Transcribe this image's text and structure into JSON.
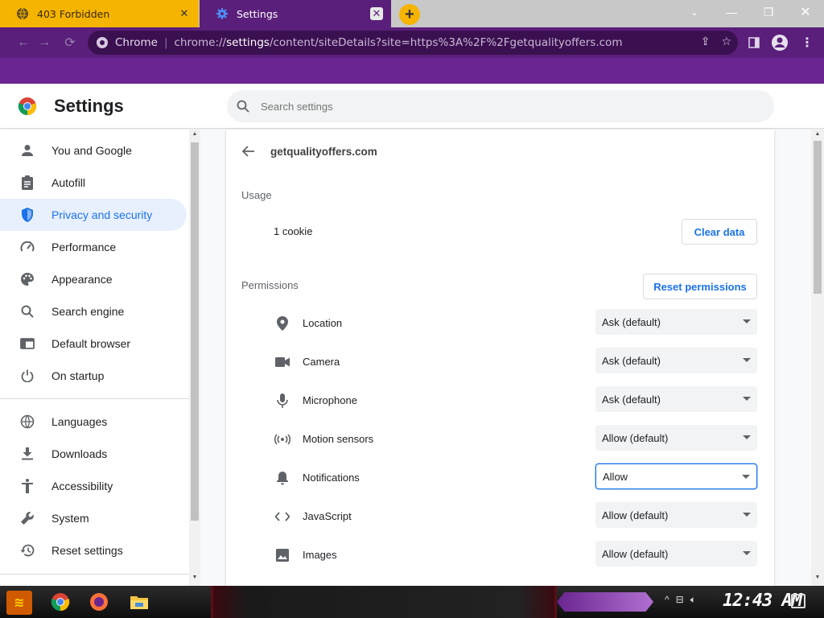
{
  "browser": {
    "tabs": [
      {
        "title": "403 Forbidden",
        "active": false
      },
      {
        "title": "Settings",
        "active": true
      }
    ],
    "new_tab": "+",
    "window_controls": {
      "dropdown": "⌄",
      "minimize": "—",
      "restore": "❐",
      "close": "✕"
    },
    "omnibox": {
      "origin_label": "Chrome",
      "separator": "|",
      "url_prefix": "chrome://",
      "url_host": "settings",
      "url_rest": "/content/siteDetails?site=https%3A%2F%2Fgetqualityoffers.com"
    }
  },
  "header": {
    "title": "Settings",
    "search_placeholder": "Search settings"
  },
  "sidebar": {
    "items": [
      {
        "label": "You and Google",
        "icon": "person-icon",
        "active": false
      },
      {
        "label": "Autofill",
        "icon": "clipboard-icon",
        "active": false
      },
      {
        "label": "Privacy and security",
        "icon": "shield-icon",
        "active": true
      },
      {
        "label": "Performance",
        "icon": "speedometer-icon",
        "active": false
      },
      {
        "label": "Appearance",
        "icon": "palette-icon",
        "active": false
      },
      {
        "label": "Search engine",
        "icon": "search-icon",
        "active": false
      },
      {
        "label": "Default browser",
        "icon": "browser-window-icon",
        "active": false
      },
      {
        "label": "On startup",
        "icon": "power-icon",
        "active": false
      },
      {
        "label": "Languages",
        "icon": "globe-icon",
        "active": false
      },
      {
        "label": "Downloads",
        "icon": "download-icon",
        "active": false
      },
      {
        "label": "Accessibility",
        "icon": "accessibility-icon",
        "active": false
      },
      {
        "label": "System",
        "icon": "wrench-icon",
        "active": false
      },
      {
        "label": "Reset settings",
        "icon": "history-icon",
        "active": false
      }
    ]
  },
  "site": {
    "title": "getqualityoffers.com",
    "usage_heading": "Usage",
    "cookie_count": "1 cookie",
    "clear_data": "Clear data",
    "permissions_heading": "Permissions",
    "reset_permissions": "Reset permissions",
    "permissions": [
      {
        "name": "Location",
        "value": "Ask (default)",
        "icon": "location-pin-icon"
      },
      {
        "name": "Camera",
        "value": "Ask (default)",
        "icon": "camera-icon"
      },
      {
        "name": "Microphone",
        "value": "Ask (default)",
        "icon": "microphone-icon"
      },
      {
        "name": "Motion sensors",
        "value": "Allow (default)",
        "icon": "motion-sensor-icon"
      },
      {
        "name": "Notifications",
        "value": "Allow",
        "icon": "bell-icon",
        "focused": true
      },
      {
        "name": "JavaScript",
        "value": "Allow (default)",
        "icon": "code-icon"
      },
      {
        "name": "Images",
        "value": "Allow (default)",
        "icon": "image-icon"
      }
    ]
  },
  "taskbar": {
    "clock": "12:43 AM"
  },
  "colors": {
    "accent": "#1a73e8",
    "active_nav_bg": "#e8f0fe",
    "toolbar": "#5a1f7a",
    "tab_inactive": "#f5b400"
  }
}
